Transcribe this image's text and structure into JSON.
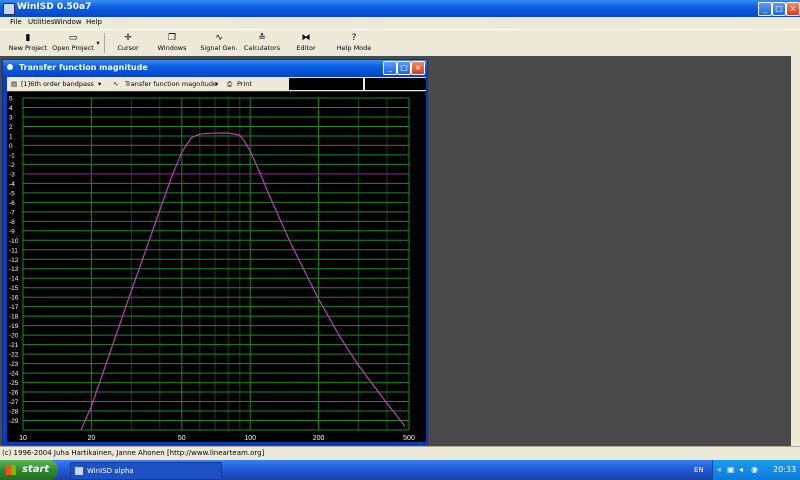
{
  "app": {
    "title": "WinISD 0.50a7"
  },
  "menu": [
    "File",
    "Utilities",
    "Window",
    "Help"
  ],
  "toolbar": [
    {
      "label": "New Project",
      "icon": "new-doc-icon"
    },
    {
      "label": "Open Project",
      "icon": "open-folder-icon"
    },
    {
      "label": "Cursor",
      "icon": "cursor-icon"
    },
    {
      "label": "Windows",
      "icon": "windows-icon"
    },
    {
      "label": "Signal Gen.",
      "icon": "sine-wave-icon"
    },
    {
      "label": "Calculators",
      "icon": "calculator-icon"
    },
    {
      "label": "Editor",
      "icon": "editor-icon"
    },
    {
      "label": "Help Mode",
      "icon": "help-icon"
    }
  ],
  "child_window": {
    "title": "Transfer function magnitude",
    "project_select": "[1]6th order bandpass",
    "graph_select": "Transfer function magnitude",
    "print_label": "Print"
  },
  "status": {
    "text": "(c) 1996-2004 Juha Hartikainen, Janne Ahonen [http://www.linearteam.org]"
  },
  "taskbar": {
    "start_label": "start",
    "task_label": "WinISD alpha",
    "lang": "EN",
    "time": "20:33"
  },
  "chart_data": {
    "type": "line",
    "x_scale": "log",
    "xlim": [
      10,
      500
    ],
    "ylim": [
      -30,
      5
    ],
    "x_ticks": [
      10,
      20,
      50,
      100,
      200,
      500
    ],
    "y_ticks": [
      5,
      4,
      3,
      2,
      1,
      0,
      -1,
      -2,
      -3,
      -4,
      -5,
      -6,
      -7,
      -8,
      -9,
      -10,
      -11,
      -12,
      -13,
      -14,
      -15,
      -16,
      -17,
      -18,
      -19,
      -20,
      -21,
      -22,
      -23,
      -24,
      -25,
      -26,
      -27,
      -28,
      -29
    ],
    "reference_lines": [
      {
        "y": 0,
        "color": "#d01818"
      },
      {
        "y": -3,
        "color": "#a000a0"
      }
    ],
    "series": [
      {
        "color": "#d040d0",
        "x": [
          18,
          20,
          25,
          30,
          35,
          40,
          45,
          50,
          55,
          60,
          70,
          80,
          90,
          95,
          100,
          110,
          120,
          150,
          200,
          250,
          300,
          400,
          480
        ],
        "y": [
          -30,
          -27.5,
          -20.8,
          -15.3,
          -10.8,
          -6.8,
          -3.4,
          -0.7,
          0.8,
          1.2,
          1.3,
          1.3,
          1.1,
          0.3,
          -0.6,
          -2.8,
          -5.0,
          -10.2,
          -16.2,
          -20.3,
          -23.2,
          -27.2,
          -29.6
        ]
      }
    ],
    "colors": {
      "background": "#000000",
      "major_grid": "#1e8c1e",
      "minor_grid": "#0e4a0e",
      "axis_text": "#ffffff"
    }
  }
}
